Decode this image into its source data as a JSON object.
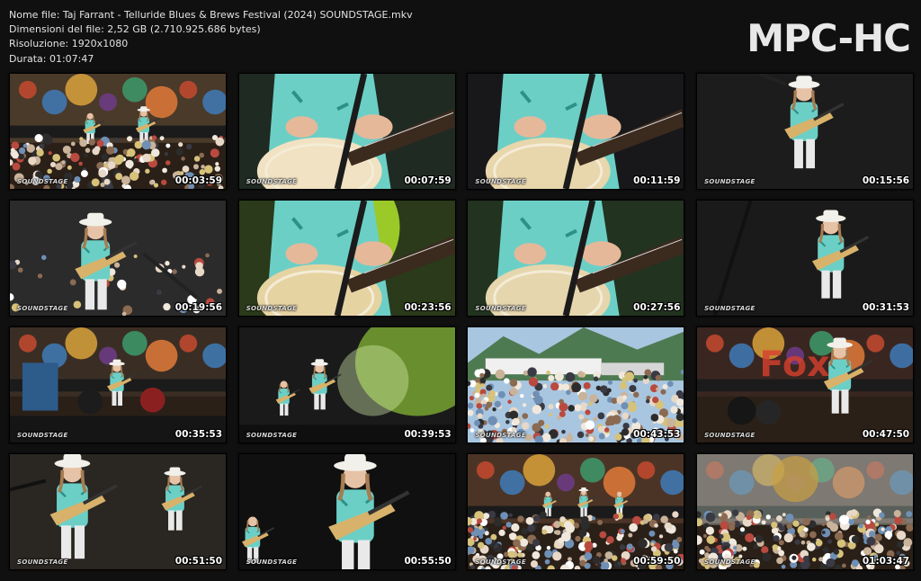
{
  "file_info": {
    "name": "Nome file: Taj Farrant - Telluride Blues & Brews Festival (2024) SOUNDSTAGE.mkv",
    "size": "Dimensioni del file: 2,52 GB (2.710.925.686 bytes)",
    "resolution": "Risoluzione: 1920x1080",
    "duration": "Durata: 01:07:47"
  },
  "logo": "MPC-HC",
  "thumbnails": [
    {
      "timestamp": "00:03:59",
      "scene": "stage-wide-crowd"
    },
    {
      "timestamp": "00:07:59",
      "scene": "guitar-closeup"
    },
    {
      "timestamp": "00:11:59",
      "scene": "guitar-neck-closeup"
    },
    {
      "timestamp": "00:15:56",
      "scene": "singer-hat-mic"
    },
    {
      "timestamp": "00:19:56",
      "scene": "singer-profile-hat"
    },
    {
      "timestamp": "00:23:56",
      "scene": "guitar-green-light"
    },
    {
      "timestamp": "00:27:56",
      "scene": "guitar-closeup-teal"
    },
    {
      "timestamp": "00:31:53",
      "scene": "player-hat-dark"
    },
    {
      "timestamp": "00:35:53",
      "scene": "stage-band-wide"
    },
    {
      "timestamp": "00:39:53",
      "scene": "stage-green-smoke"
    },
    {
      "timestamp": "00:43:53",
      "scene": "crowd-mountains"
    },
    {
      "timestamp": "00:47:50",
      "scene": "stage-drums-player"
    },
    {
      "timestamp": "00:51:50",
      "scene": "player-hair-mic"
    },
    {
      "timestamp": "00:55:50",
      "scene": "player-closeup-hat"
    },
    {
      "timestamp": "00:59:50",
      "scene": "stage-wide-crowd-2"
    },
    {
      "timestamp": "01:03:47",
      "scene": "stage-hazy-crowd"
    }
  ],
  "watermark": "SOUNDSTAGE",
  "colors": {
    "background": "#101010",
    "shirt_teal": "#6ccfc6",
    "text": "#e2e2e2"
  }
}
